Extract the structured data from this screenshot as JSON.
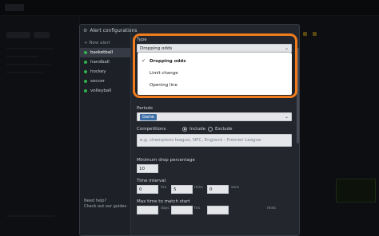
{
  "modal": {
    "title": "Alert configurations",
    "new_alert": "+ New alert",
    "sports": [
      {
        "label": "basketball",
        "active": true
      },
      {
        "label": "handball",
        "active": false
      },
      {
        "label": "hockey",
        "active": false
      },
      {
        "label": "soccer",
        "active": false
      },
      {
        "label": "volleyball",
        "active": false
      }
    ],
    "help_title": "Need help?",
    "help_link": "Check out our guides"
  },
  "form": {
    "type_label": "Type",
    "type_value": "Dropping odds",
    "type_options": [
      {
        "label": "Dropping odds",
        "selected": true
      },
      {
        "label": "Limit change",
        "selected": false
      },
      {
        "label": "Opening line",
        "selected": false
      }
    ],
    "periods_label": "Periods",
    "periods_tag": "Game",
    "competitions_label": "Competitions",
    "include_label": "Include",
    "exclude_label": "Exclude",
    "competitions_placeholder": "e.g. champions league, NFC, England - Premier League",
    "min_drop_label": "Minimum drop percentage",
    "min_drop_value": "10",
    "time_interval_label": "Time interval",
    "time_interval": {
      "hrs": "0",
      "hrs_unit": "hrs",
      "mins": "5",
      "mins_unit": "mins",
      "secs": "0",
      "secs_unit": "secs"
    },
    "max_time_label": "Max time to match start",
    "max_time_units": [
      "days",
      "hrs",
      "mins"
    ]
  },
  "colors": {
    "accent_highlight": "#f07c1e",
    "status_dot": "#2fb34a",
    "tag": "#3d6ea5"
  }
}
